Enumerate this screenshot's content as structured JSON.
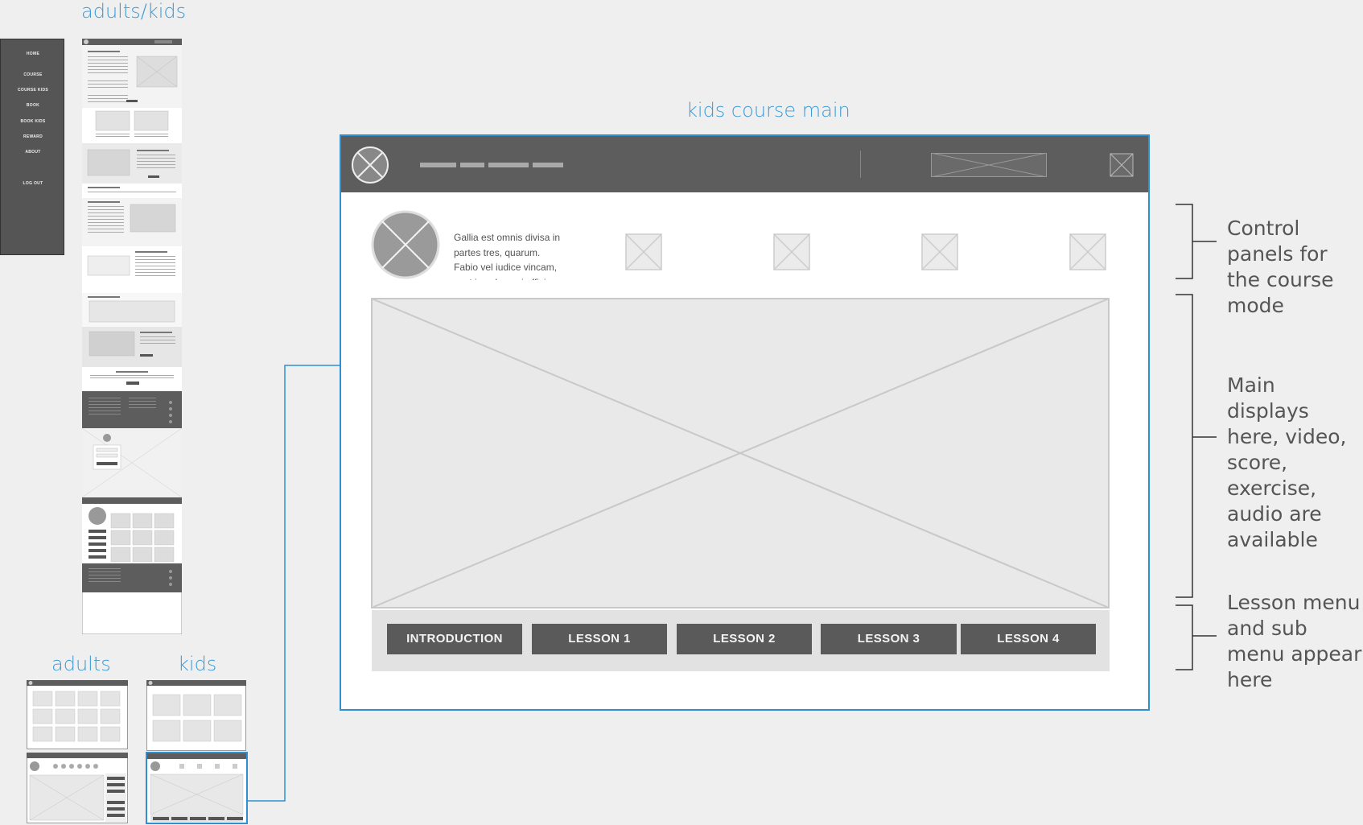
{
  "captions": {
    "adults_kids": "adults/kids",
    "adults": "adults",
    "kids": "kids",
    "kids_course_main": "kids course main"
  },
  "side_nav": {
    "items": [
      "HOME",
      "COURSE",
      "COURSE KIDS",
      "BOOK",
      "BOOK KIDS",
      "REWARD",
      "ABOUT",
      "LOG OUT"
    ]
  },
  "main": {
    "intro_text": "Gallia est omnis divisa in partes tres, quarum. Fabio vel iudice vincam, sunt in culpa qui officia.",
    "lessons": [
      "INTRODUCTION",
      "LESSON 1",
      "LESSON 2",
      "LESSON 3",
      "LESSON 4"
    ]
  },
  "annotations": {
    "control": "Control panels for the course mode",
    "main_display": "Main displays here, video, score, exercise, audio are available",
    "lesson_menu": "Lesson menu and sub menu appear here"
  },
  "colors": {
    "accent": "#2f8fd0",
    "caption": "#3d9bd6",
    "dark_bar": "#5d5d5d",
    "button": "#5a5a5a",
    "placeholder": "#e8e8e8"
  }
}
